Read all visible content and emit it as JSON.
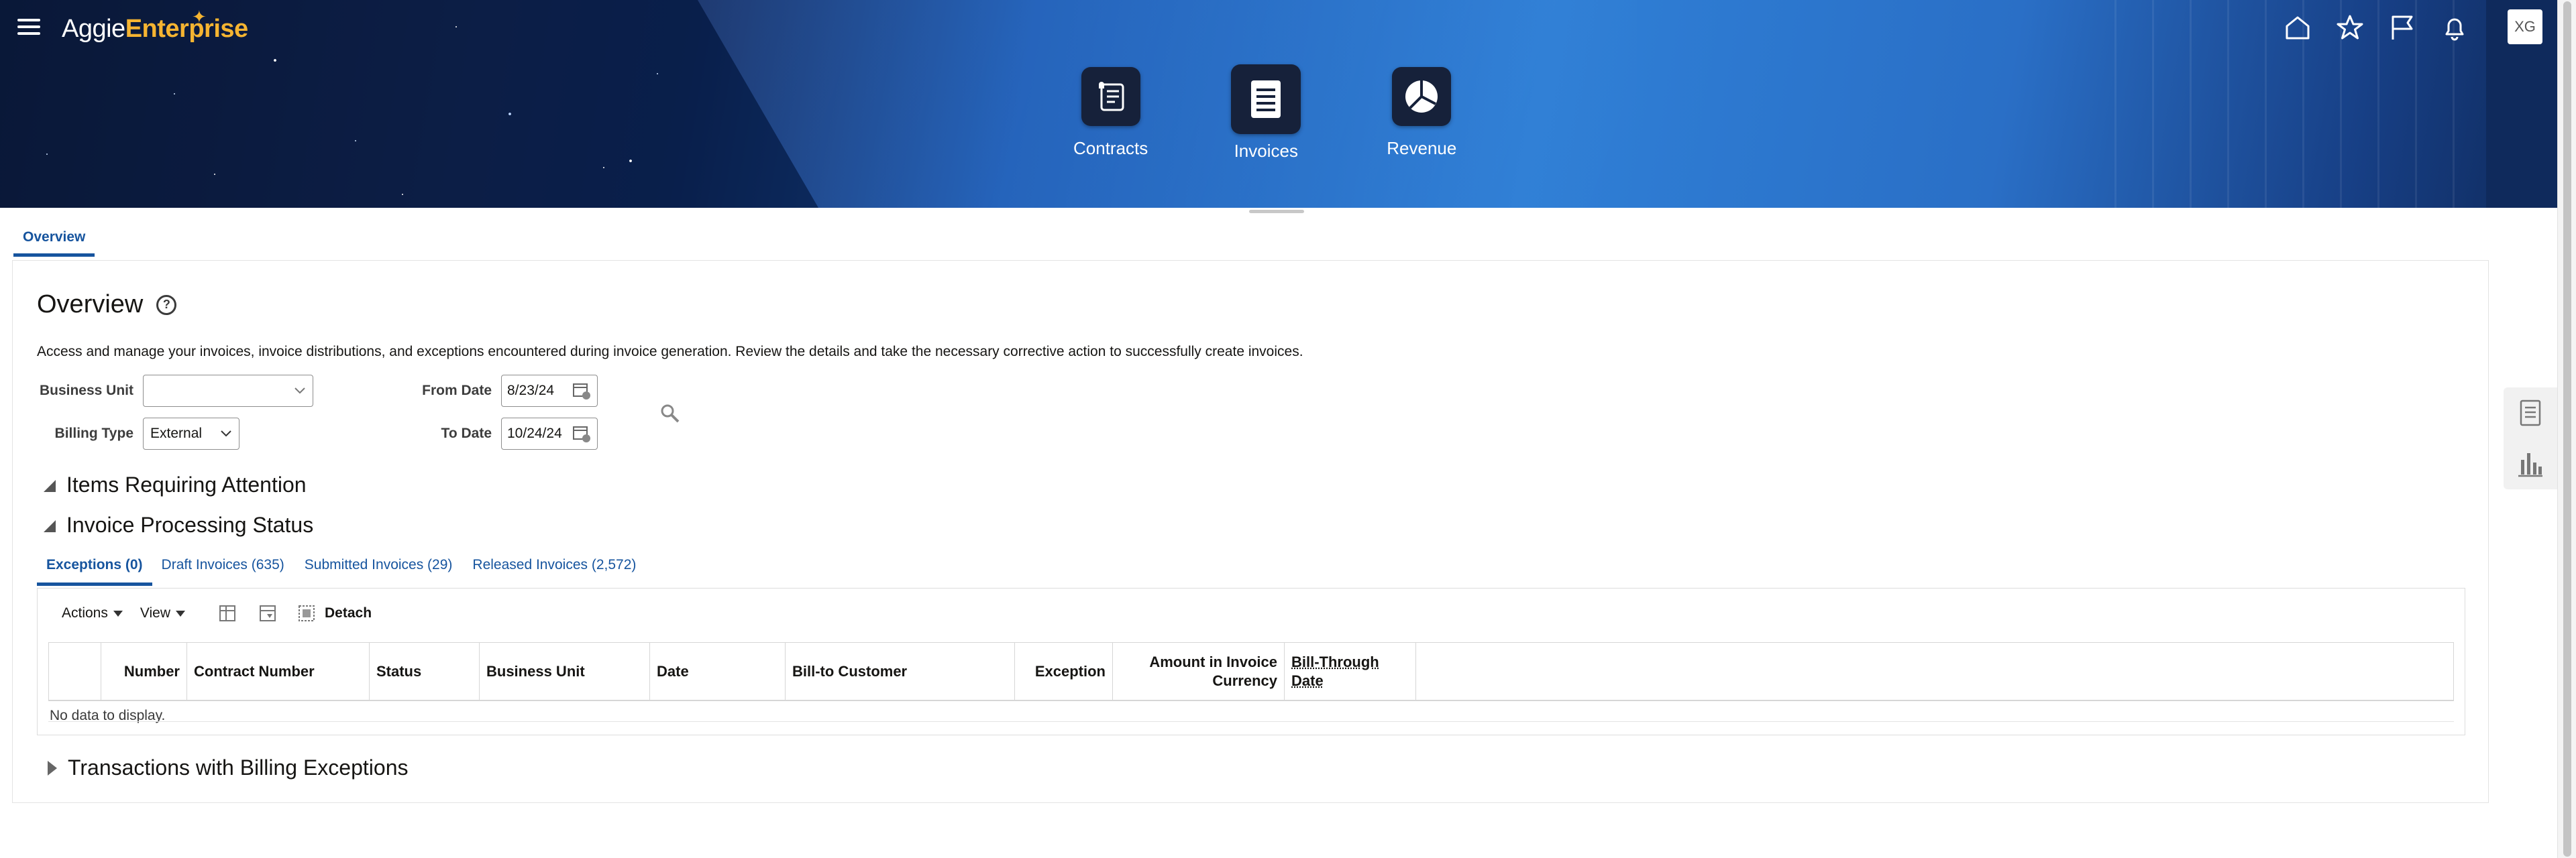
{
  "header": {
    "logo_light": "Aggie",
    "logo_bold": "Enterprise",
    "user_initials": "XG",
    "springboard": [
      {
        "label": "Contracts",
        "icon": "contract-scroll-icon"
      },
      {
        "label": "Invoices",
        "icon": "invoice-document-icon"
      },
      {
        "label": "Revenue",
        "icon": "pie-chart-icon"
      }
    ],
    "icons": [
      "home-icon",
      "star-icon",
      "flag-icon",
      "bell-icon"
    ]
  },
  "page_tabs": [
    {
      "label": "Overview"
    }
  ],
  "overview": {
    "title": "Overview",
    "description": "Access and manage your invoices, invoice distributions, and exceptions encountered during invoice generation. Review the details and take the necessary corrective action to successfully create invoices.",
    "filters": {
      "business_unit_label": "Business Unit",
      "business_unit_value": "",
      "billing_type_label": "Billing Type",
      "billing_type_value": "External",
      "from_date_label": "From Date",
      "from_date_value": "8/23/24",
      "to_date_label": "To Date",
      "to_date_value": "10/24/24"
    },
    "sections": {
      "items_requiring_attention": "Items Requiring Attention",
      "invoice_processing_status": "Invoice Processing Status",
      "transactions_with_billing_exceptions": "Transactions with Billing Exceptions"
    },
    "status_tabs": [
      {
        "label": "Exceptions (0)"
      },
      {
        "label": "Draft Invoices (635)"
      },
      {
        "label": "Submitted Invoices (29)"
      },
      {
        "label": "Released Invoices (2,572)"
      }
    ],
    "toolbar": {
      "actions_label": "Actions",
      "view_label": "View",
      "detach_label": "Detach"
    },
    "table": {
      "columns": [
        {
          "label": "Number"
        },
        {
          "label": "Contract Number"
        },
        {
          "label": "Status"
        },
        {
          "label": "Business Unit"
        },
        {
          "label": "Date"
        },
        {
          "label": "Bill-to Customer"
        },
        {
          "label": "Exception"
        },
        {
          "label_line1": "Amount in Invoice",
          "label_line2": "Currency"
        },
        {
          "label_line1": "Bill-Through",
          "label_line2": "Date"
        }
      ],
      "empty_message": "No data to display."
    }
  },
  "colors": {
    "link_blue": "#16549e",
    "brand_gold": "#f5b431",
    "banner_dark": "#0f2a5c",
    "tile_dark": "#16213a"
  }
}
